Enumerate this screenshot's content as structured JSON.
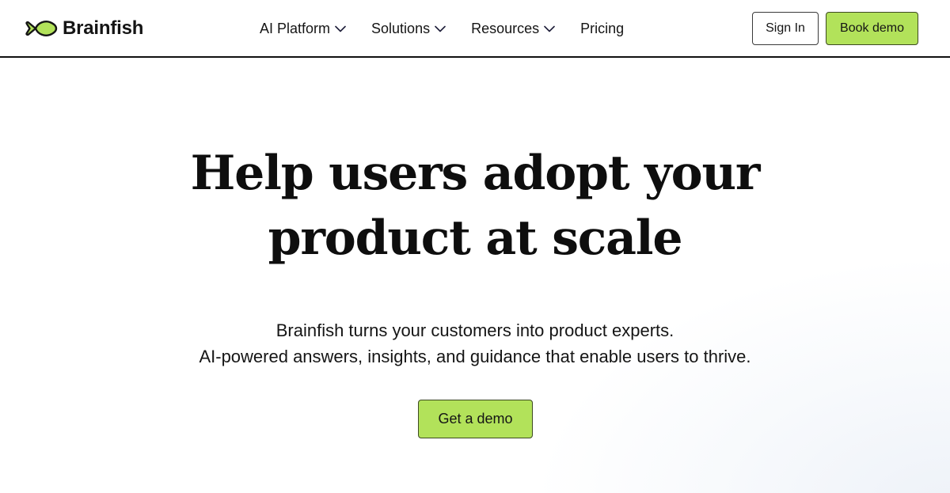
{
  "brand": {
    "name": "Brainfish",
    "logo_icon": "fish-icon",
    "accent_color": "#b2e25a"
  },
  "nav": {
    "items": [
      {
        "label": "AI Platform",
        "has_dropdown": true,
        "icon": "chevron-down-icon"
      },
      {
        "label": "Solutions",
        "has_dropdown": true,
        "icon": "chevron-down-icon"
      },
      {
        "label": "Resources",
        "has_dropdown": true,
        "icon": "chevron-down-icon"
      },
      {
        "label": "Pricing",
        "has_dropdown": false
      }
    ]
  },
  "header_actions": {
    "sign_in_label": "Sign In",
    "book_demo_label": "Book demo"
  },
  "hero": {
    "title_lines": [
      "Help users adopt your",
      "product at scale"
    ],
    "subtitle_lines": [
      "Brainfish turns your customers into product experts.",
      "AI-powered answers, insights, and guidance that enable users to thrive."
    ],
    "cta_label": "Get a demo"
  }
}
